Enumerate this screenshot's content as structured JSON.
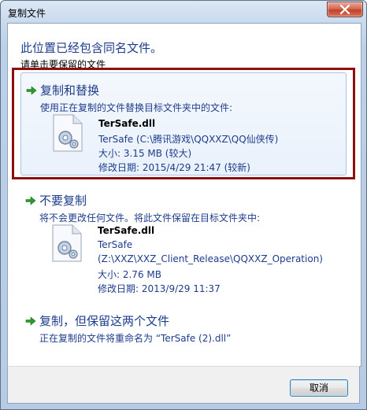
{
  "window": {
    "title": "复制文件",
    "close_label": "×"
  },
  "dialog": {
    "heading": "此位置已经包含同名文件。",
    "subheading": "请单击要保留的文件"
  },
  "options": [
    {
      "title": "复制和替换",
      "description": "使用正在复制的文件替换目标文件夹中的文件:",
      "file": {
        "name": "TerSafe.dll",
        "lines": [
          "TerSafe (C:\\腾讯游戏\\QQXXZ\\QQ仙侠传)",
          "大小: 3.15 MB (较大)",
          "修改日期: 2015/4/29 21:47 (较新)"
        ]
      }
    },
    {
      "title": "不要复制",
      "description": "将不会更改任何文件。将此文件保留在目标文件夹中:",
      "file": {
        "name": "TerSafe.dll",
        "lines": [
          "TerSafe",
          "(Z:\\XXZ\\XXZ_Client_Release\\QQXXZ_Operation)",
          "大小: 2.76 MB",
          "修改日期: 2013/9/29 11:37"
        ]
      }
    },
    {
      "title": "复制，但保留这两个文件",
      "description": "正在复制的文件将重命名为 “TerSafe (2).dll”"
    }
  ],
  "footer": {
    "cancel_label": "取消"
  },
  "colors": {
    "link_blue": "#1e3c8c",
    "arrow_green": "#2c9a2c",
    "highlight_red": "#8b1010"
  },
  "icons": {
    "arrow": "green-arrow-icon",
    "file": "dll-file-icon",
    "close": "close-icon"
  }
}
